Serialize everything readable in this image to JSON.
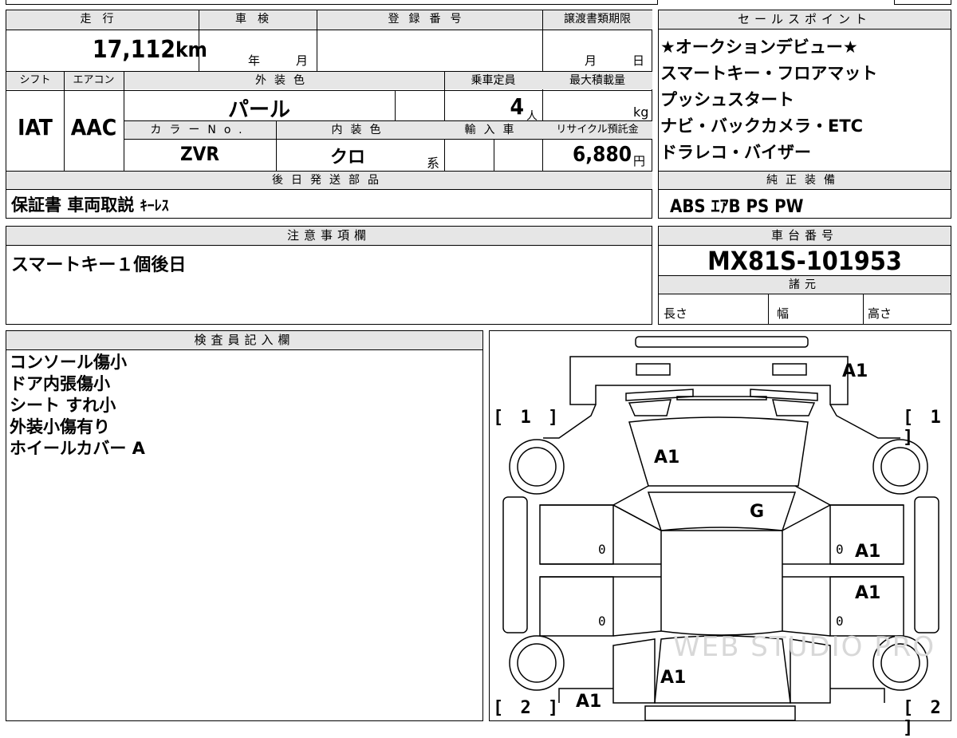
{
  "left_table": {
    "mileage_label": "走行",
    "mileage_value": "17,112",
    "mileage_unit": "km",
    "shaken_label": "車検",
    "shaken_year_label": "年",
    "shaken_month_label": "月",
    "reg_number_label": "登録番号",
    "transfer_deadline_label": "譲渡書類期限",
    "transfer_month_label": "月",
    "transfer_day_label": "日",
    "shift_label": "シフト",
    "shift_value": "IAT",
    "ac_label": "エアコン",
    "ac_value": "AAC",
    "exterior_color_label": "外装色",
    "exterior_color_value": "パール",
    "color_no_label": "カラーNo.",
    "color_no_value": "ZVR",
    "interior_color_label": "内装色",
    "interior_color_value": "クロ",
    "interior_suffix": "系",
    "capacity_label": "乗車定員",
    "capacity_value": "4",
    "capacity_unit": "人",
    "max_load_label": "最大積載量",
    "max_load_unit": "kg",
    "import_label": "輸入車",
    "recycle_label": "リサイクル預託金",
    "recycle_value": "6,880",
    "recycle_unit": "円",
    "later_parts_label": "後日発送部品",
    "later_parts_value": "保証書 車両取説",
    "later_parts_small": "ｷｰﾚｽ"
  },
  "sales_points": {
    "label": "セールスポイント",
    "lines": [
      "★オークションデビュー★",
      "スマートキー・フロアマット",
      "プッシュスタート",
      "ナビ・バックカメラ・ETC",
      "ドラレコ・バイザー"
    ]
  },
  "genuine_equipment": {
    "label": "純正装備",
    "value": "ABS ｴｱB PS PW"
  },
  "notes": {
    "label": "注意事項欄",
    "value": "スマートキー１個後日"
  },
  "chassis": {
    "label": "車台番号",
    "value": "MX81S-101953",
    "specs_label": "諸元",
    "length_label": "長さ",
    "width_label": "幅",
    "height_label": "高さ"
  },
  "inspector": {
    "label": "検査員記入欄",
    "lines": [
      "コンソール傷小",
      "ドア内張傷小",
      "シート すれ小",
      "外装小傷有り",
      "ホイールカバー A"
    ]
  },
  "diagram": {
    "marks": {
      "rear_top": "A1",
      "hood": "A1",
      "windshield": "G",
      "right_front_door": "A1",
      "right_rear_door": "A1",
      "rear_window": "A1",
      "left_rear": "A1"
    },
    "door_zero": "0",
    "brackets": {
      "front_left": "[ 1 ]",
      "front_right": "[ 1 ]",
      "rear_left": "[ 2 ]",
      "rear_right": "[ 2 ]"
    },
    "watermark": "WEB STUDIO PRO"
  }
}
